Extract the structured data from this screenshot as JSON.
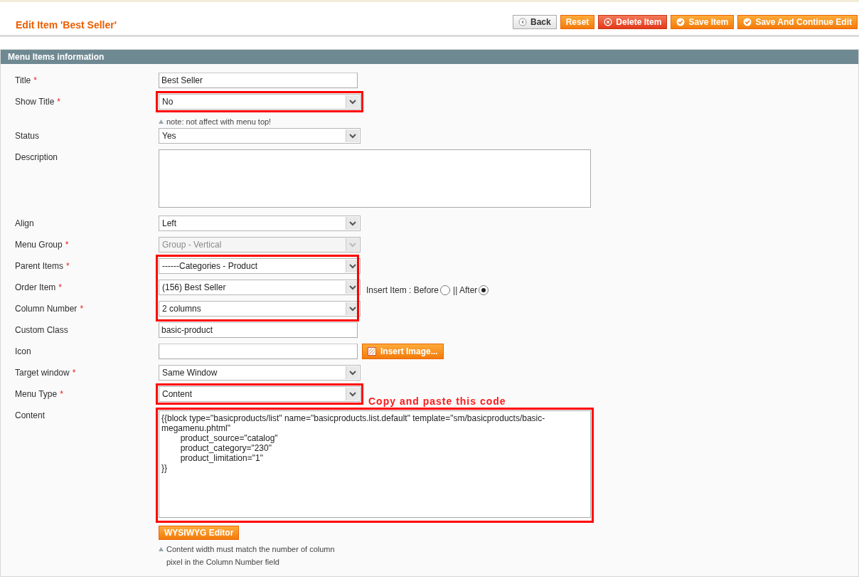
{
  "page_title": "Edit Item 'Best Seller'",
  "buttons": [
    {
      "label": "Back",
      "kind": "back"
    },
    {
      "label": "Reset",
      "kind": "plain"
    },
    {
      "label": "Delete Item",
      "kind": "delete"
    },
    {
      "label": "Save Item",
      "kind": "save"
    },
    {
      "label": "Save And Continue Edit",
      "kind": "save"
    }
  ],
  "section_title": "Menu Items information",
  "fields": [
    {
      "kind": "text",
      "label": "Title",
      "marker": "*",
      "highlighted": false,
      "value": "Best Seller"
    },
    {
      "kind": "select",
      "label": "Show Title",
      "marker": "*",
      "highlighted": true,
      "disabled": false,
      "value": "No",
      "note": "note: not affect with menu top!"
    },
    {
      "kind": "select",
      "label": "Status",
      "highlighted": false,
      "disabled": false,
      "value": "Yes"
    },
    {
      "kind": "textarea",
      "label": "Description",
      "highlighted": false
    },
    {
      "kind": "select",
      "label": "Align",
      "highlighted": false,
      "disabled": false,
      "value": "Left"
    },
    {
      "kind": "select",
      "label": "Menu Group",
      "marker": "*",
      "highlighted": false,
      "disabled": true,
      "value": "Group - Vertical"
    },
    {
      "kind": "group",
      "highlighted": true,
      "fields": [
        {
          "kind": "select",
          "label": "Parent Items",
          "marker": "*",
          "disabled": false,
          "value": "------Categories - Product"
        },
        {
          "kind": "select",
          "label": "Order Item",
          "marker": "*",
          "disabled": false,
          "value": "(156) Best Seller",
          "radios": {
            "label": "Insert Item : Before",
            "options": [
              {
                "selected": false
              },
              {
                "label": "|| After",
                "selected": true
              }
            ]
          }
        },
        {
          "kind": "select",
          "label": "Column Number",
          "marker": "*",
          "disabled": false,
          "value": "2 columns"
        }
      ]
    },
    {
      "kind": "text",
      "label": "Custom Class",
      "highlighted": false,
      "value": "basic-product"
    },
    {
      "kind": "image",
      "label": "Icon",
      "highlighted": false,
      "button": "Insert Image..."
    },
    {
      "kind": "select",
      "label": "Target window",
      "marker": "*",
      "highlighted": false,
      "disabled": false,
      "value": "Same Window"
    },
    {
      "kind": "select",
      "label": "Menu Type",
      "marker": "*",
      "highlighted": true,
      "disabled": false,
      "value": "Content"
    },
    {
      "kind": "content",
      "label": "Content",
      "highlighted": true,
      "annotation": "Copy and paste this code",
      "value": "{{block type=\"basicproducts/list\" name=\"basicproducts.list.default\" template=\"sm/basicproducts/basic-megamenu.phtml\"\n        product_source=\"catalog\"\n        product_category=\"230\"\n        product_limitation=\"1\"\n}}",
      "button": "WYSIWYG Editor",
      "note": "Content width must match the number of column pixel in the Column Number field"
    }
  ]
}
